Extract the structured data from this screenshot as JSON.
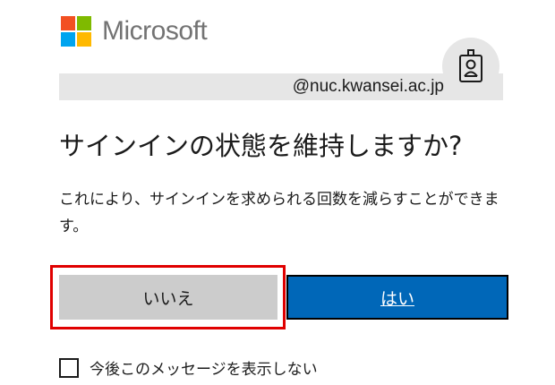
{
  "brand": {
    "name": "Microsoft",
    "colors": {
      "red": "#f25022",
      "green": "#7fba00",
      "blue": "#00a4ef",
      "yellow": "#ffb900",
      "text": "#737373"
    }
  },
  "account": {
    "email": "@nuc.kwansei.ac.jp",
    "icon": "badge-icon"
  },
  "dialog": {
    "title": "サインインの状態を維持しますか?",
    "description": "これにより、サインインを求められる回数を減らすことができます。"
  },
  "buttons": {
    "no_label": "いいえ",
    "yes_label": "はい",
    "primary_color": "#0067b8",
    "secondary_color": "#cccccc",
    "highlight_color": "#e00000"
  },
  "checkbox": {
    "label": "今後このメッセージを表示しない",
    "checked": false
  }
}
